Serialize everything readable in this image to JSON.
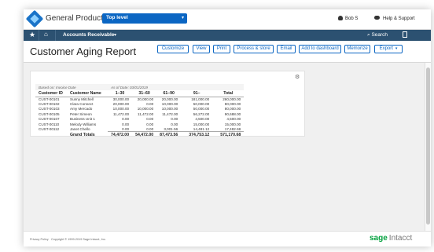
{
  "header": {
    "company": "General Product",
    "entity": "Top level",
    "user": "Bob S",
    "help": "Help & Support"
  },
  "nav": {
    "module": "Accounts Receivable",
    "search": "Search"
  },
  "page": {
    "title": "Customer Aging Report",
    "actions": {
      "customize": "Customize",
      "view": "View",
      "print": "Print",
      "process_store": "Process & store",
      "email": "Email",
      "add_dashboard": "Add to dashboard",
      "memorize": "Memorize",
      "export": "Export"
    }
  },
  "report": {
    "based_on": "Based on: Invoice Date",
    "as_of": "As of Date: 03/01/2019",
    "columns": [
      "Customer ID",
      "Customer Name",
      "1–30",
      "31–60",
      "61–90",
      "91–",
      "Total"
    ],
    "rows": [
      [
        "CUST-00101",
        "Sunny Mitchell",
        "30,000.00",
        "20,000.00",
        "20,000.00",
        "181,000.00",
        "260,000.00"
      ],
      [
        "CUST-00102",
        "Clara Connect",
        "20,000.00",
        "0.00",
        "10,000.00",
        "50,000.00",
        "80,000.00"
      ],
      [
        "CUST-00103",
        "Amy Mercado",
        "10,000.00",
        "10,000.00",
        "10,000.00",
        "50,000.00",
        "80,000.00"
      ],
      [
        "CUST-00105",
        "Peter Simeon",
        "11,472.00",
        "11,472.00",
        "11,472.00",
        "56,272.00",
        "90,688.00"
      ],
      [
        "CUST-00107",
        "Business Unit 1",
        "0.00",
        "0.00",
        "0.00",
        "4,500.00",
        "4,500.00"
      ],
      [
        "CUST-00110",
        "Melody Williams",
        "0.00",
        "0.00",
        "0.00",
        "15,000.00",
        "15,000.00"
      ],
      [
        "CUST-00112",
        "Janet Chello",
        "0.00",
        "0.00",
        "3,001.56",
        "14,481.12",
        "17,482.68"
      ]
    ],
    "totals": {
      "label": "Grand Totals",
      "values": [
        "74,472.00",
        "54,472.00",
        "87,473.56",
        "374,753.12",
        "571,170.68"
      ]
    }
  },
  "footer": {
    "privacy": "Privacy Policy",
    "copyright": "Copyright © 1999-2019 Sage Intacct, Inc.",
    "brand_sage": "sage",
    "brand_intacct": "Intacct"
  },
  "colors": {
    "accent": "#0b66c3",
    "navbar": "#2c5171",
    "brand_green": "#00a03c"
  },
  "icons": {
    "logo": "company-logo",
    "star": "star-icon",
    "home": "home-icon",
    "gear": "gear-icon",
    "search": "search-icon"
  }
}
